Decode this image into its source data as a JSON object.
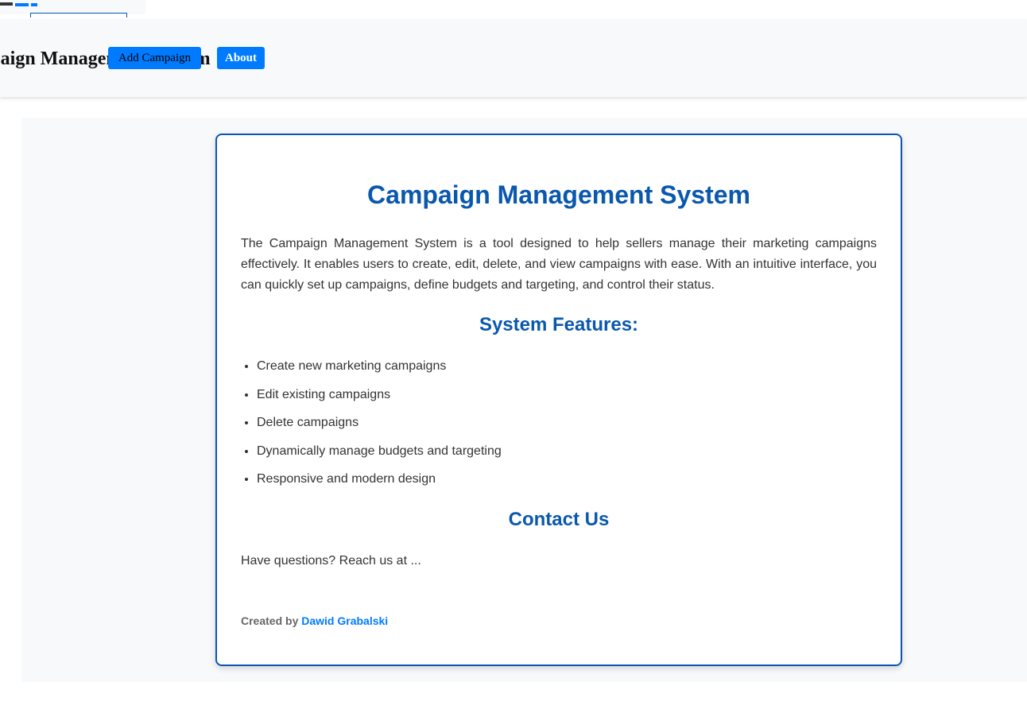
{
  "navbar": {
    "brand": "Campaign Management System",
    "add_campaign_label": "Add Campaign",
    "about_label": "About"
  },
  "about": {
    "title": "Campaign Management System",
    "description": "The Campaign Management System is a tool designed to help sellers manage their marketing campaigns effectively. It enables users to create, edit, delete, and view campaigns with ease. With an intuitive interface, you can quickly set up campaigns, define budgets and targeting, and control their status.",
    "features_heading": "System Features:",
    "features": [
      "Create new marketing campaigns",
      "Edit existing campaigns",
      "Delete campaigns",
      "Dynamically manage budgets and targeting",
      "Responsive and modern design"
    ],
    "contact_heading": "Contact Us",
    "contact_text": "Have questions? Reach us at ...",
    "created_by_prefix": "Created by",
    "author": "Dawid Grabalski"
  },
  "colors": {
    "accent": "#0a58ad",
    "button": "#007bff",
    "background": "#f8f9fa"
  }
}
